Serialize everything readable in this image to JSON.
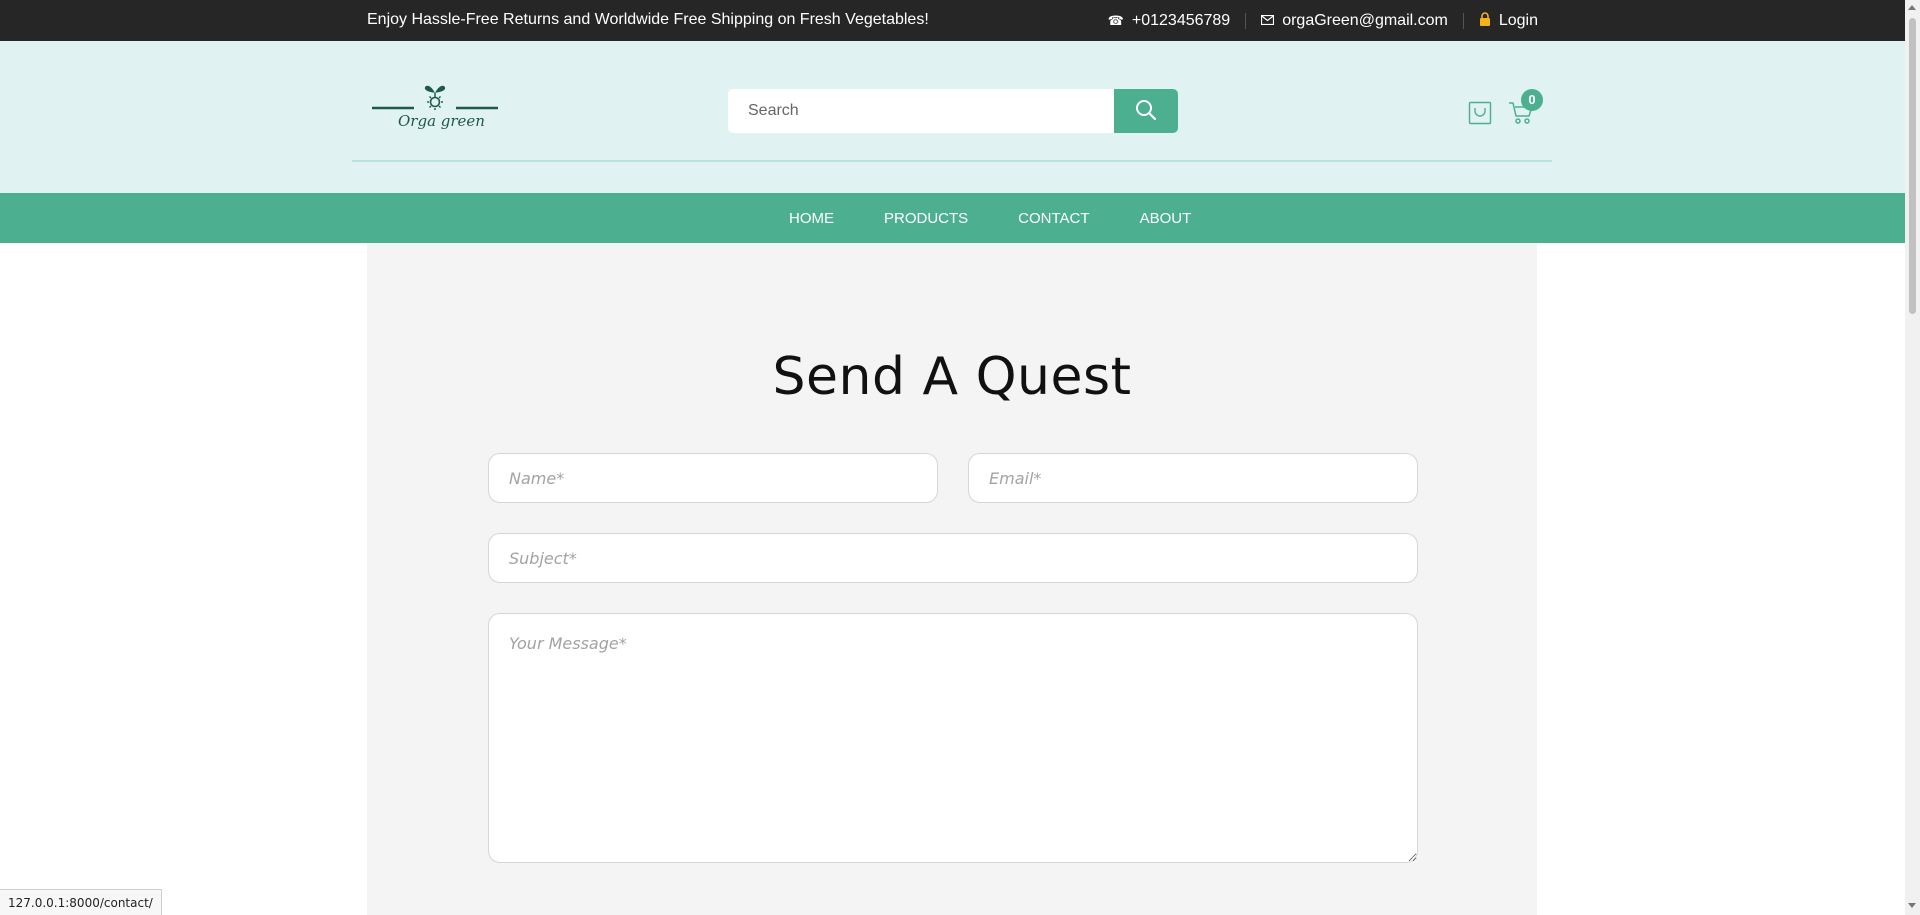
{
  "topbar": {
    "promo": "Enjoy Hassle-Free Returns and Worldwide Free Shipping on Fresh Vegetables!",
    "phone": "+0123456789",
    "email": "orgaGreen@gmail.com",
    "login": "Login"
  },
  "header": {
    "logo_text": "Orga green",
    "search_placeholder": "Search",
    "cart_count": "0"
  },
  "nav": {
    "items": [
      "HOME",
      "PRODUCTS",
      "CONTACT",
      "ABOUT"
    ]
  },
  "contact_form": {
    "title": "Send A Quest",
    "name_placeholder": "Name*",
    "email_placeholder": "Email*",
    "subject_placeholder": "Subject*",
    "message_placeholder": "Your Message*"
  },
  "status_url": "127.0.0.1:8000/contact/",
  "colors": {
    "topbar_bg": "#262626",
    "header_bg": "#e0f2f1",
    "accent": "#4caf8f",
    "content_bg": "#f4f4f4",
    "login_lock": "#f5b21b"
  },
  "icons": {
    "phone": "phone-icon",
    "email": "mail-icon",
    "login": "lock-icon",
    "search": "search-icon",
    "bag": "shopping-bag-icon",
    "cart": "cart-icon"
  }
}
